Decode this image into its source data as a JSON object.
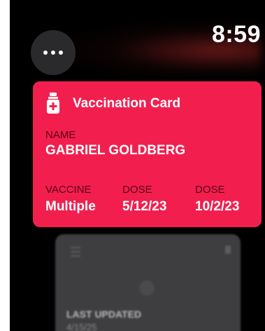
{
  "status": {
    "time": "8:59"
  },
  "card": {
    "title": "Vaccination Card",
    "color": "#f21f4e",
    "icon": "vaccine-vial-icon",
    "name_label": "NAME",
    "name_value": "GABRIEL GOLDBERG",
    "fields": [
      {
        "label": "VACCINE",
        "value": "Multiple"
      },
      {
        "label": "DOSE",
        "value": "5/12/23"
      },
      {
        "label": "DOSE",
        "value": "10/2/23"
      }
    ]
  },
  "back_card": {
    "label": "LAST UPDATED",
    "value": "4/15/25"
  }
}
